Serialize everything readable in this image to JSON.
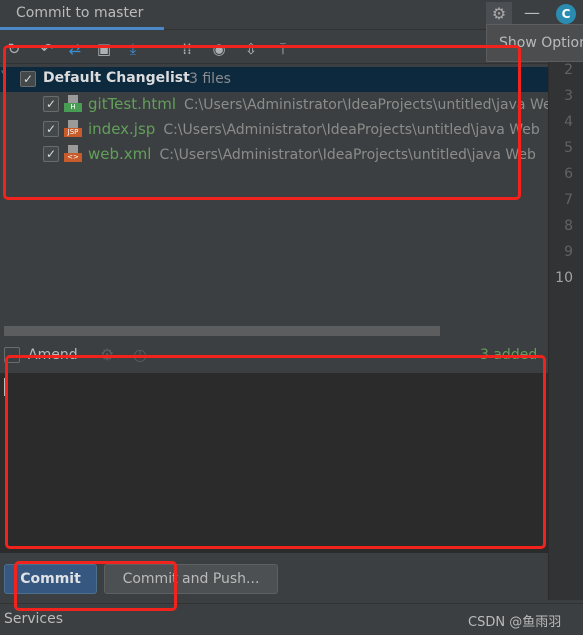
{
  "tab": {
    "title": "Commit to master"
  },
  "window": {
    "tooltip": "Show Options"
  },
  "toolbar": {
    "icons": [
      "refresh-icon",
      "rollback-icon",
      "diff-icon",
      "shelve-icon",
      "update-icon",
      "group-by-icon",
      "view-options-icon",
      "expand-all-icon",
      "collapse-all-icon"
    ]
  },
  "changelist": {
    "name": "Default Changelist",
    "count": "3 files",
    "files": [
      {
        "name": "gitTest.html",
        "path": "C:\\Users\\Administrator\\IdeaProjects\\untitled\\java Web",
        "type": "H",
        "color": "#499c54"
      },
      {
        "name": "index.jsp",
        "path": "C:\\Users\\Administrator\\IdeaProjects\\untitled\\java Web",
        "type": "JSP",
        "color": "#c75b2a"
      },
      {
        "name": "web.xml",
        "path": "C:\\Users\\Administrator\\IdeaProjects\\untitled\\java Web",
        "type": "<>",
        "color": "#c75b2a"
      }
    ]
  },
  "gutter": {
    "lines": [
      "2",
      "3",
      "4",
      "5",
      "6",
      "7",
      "8",
      "9",
      "10"
    ]
  },
  "amend": {
    "label": "Amend",
    "status": "3 added"
  },
  "message": {
    "value": ""
  },
  "buttons": {
    "commit": "Commit",
    "commit_push": "Commit and Push..."
  },
  "statusbar": {
    "services": "Services",
    "watermark": "CSDN @鱼雨羽"
  }
}
